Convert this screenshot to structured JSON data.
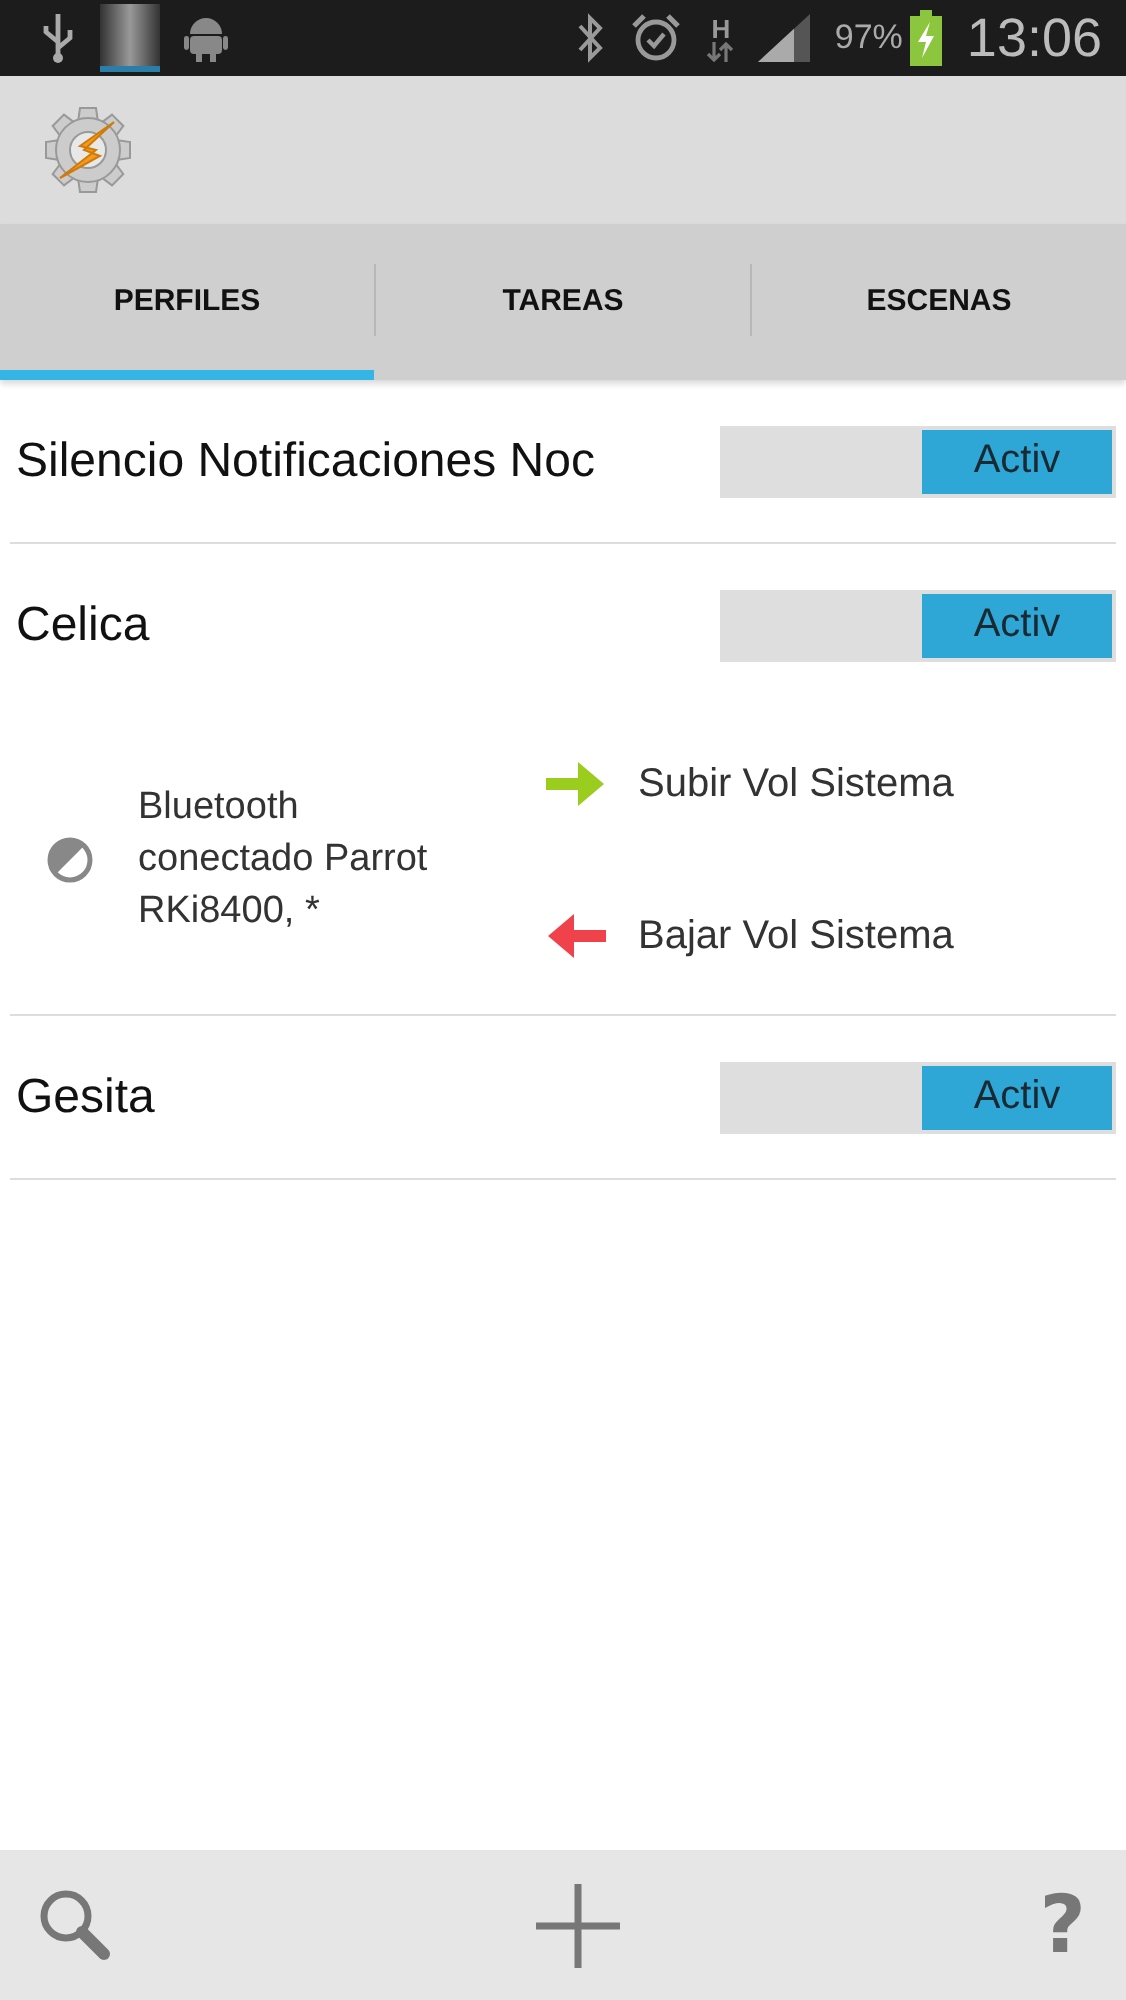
{
  "status_bar": {
    "network": "H",
    "battery": "97%",
    "time": "13:06"
  },
  "tabs": [
    {
      "label": "PERFILES",
      "selected": true
    },
    {
      "label": "TAREAS",
      "selected": false
    },
    {
      "label": "ESCENAS",
      "selected": false
    }
  ],
  "profiles": [
    {
      "name": "Silencio Notificaciones Noc",
      "toggle": "Activ",
      "on": true,
      "expanded": false
    },
    {
      "name": "Celica",
      "toggle": "Activ",
      "on": true,
      "expanded": true,
      "context": "Bluetooth conectado Parrot RKi8400, *",
      "tasks": [
        {
          "kind": "enter",
          "label": "Subir Vol Sistema"
        },
        {
          "kind": "exit",
          "label": "Bajar Vol Sistema"
        }
      ]
    },
    {
      "name": "Gesita",
      "toggle": "Activ",
      "on": true,
      "expanded": false
    }
  ],
  "bottom_bar": {
    "help": "?"
  }
}
